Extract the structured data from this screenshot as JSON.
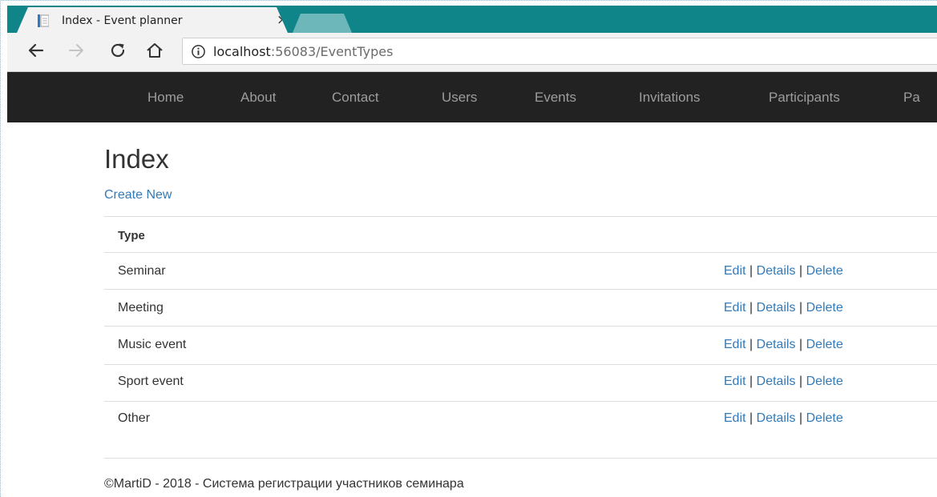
{
  "browser": {
    "tab": {
      "title": "Index - Event planner",
      "close": "×"
    },
    "url": {
      "host": "localhost",
      "rest": ":56083/EventTypes"
    }
  },
  "navbar": {
    "items": [
      "Home",
      "About",
      "Contact",
      "Users",
      "Events",
      "Invitations",
      "Participants",
      "Pa"
    ]
  },
  "page": {
    "title": "Index",
    "create_link": "Create New",
    "table": {
      "column_header": "Type",
      "rows": [
        {
          "type": "Seminar"
        },
        {
          "type": "Meeting"
        },
        {
          "type": "Music event"
        },
        {
          "type": "Sport event"
        },
        {
          "type": "Other"
        }
      ],
      "actions": {
        "edit": "Edit",
        "details": "Details",
        "delete": "Delete",
        "separator": "|"
      }
    },
    "footer": "©MartiD - 2018 - Система регистрации участников семинара"
  },
  "colors": {
    "tabstrip": "#0f8489",
    "navbar": "#222222",
    "link": "#337ab7"
  }
}
